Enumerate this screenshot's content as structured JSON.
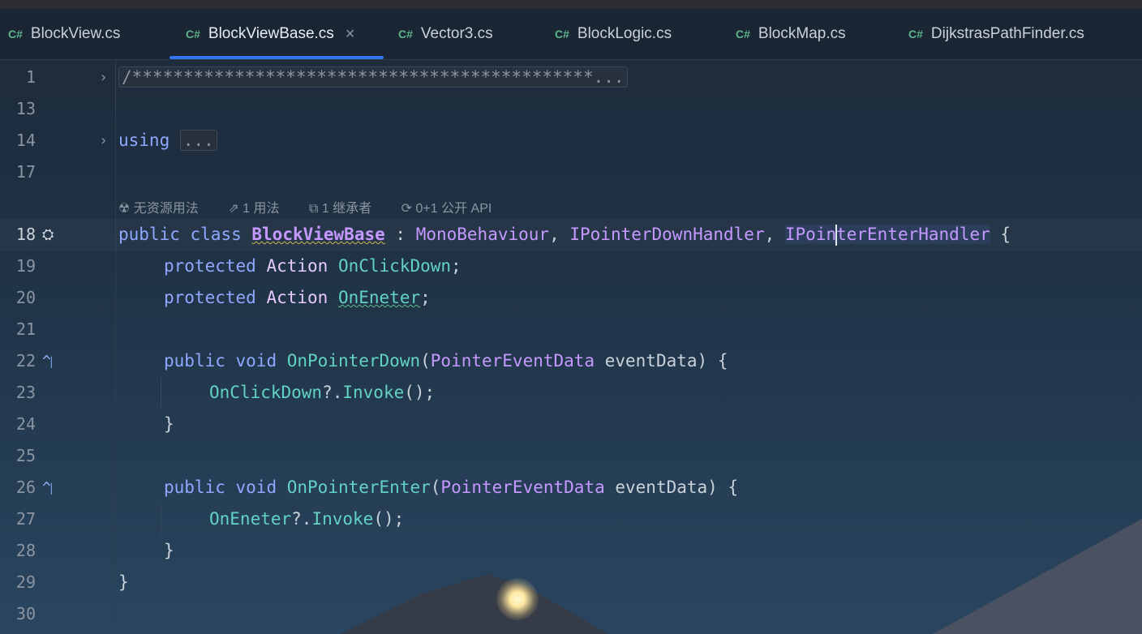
{
  "tabs": [
    {
      "icon": "C#",
      "label": "BlockView.cs"
    },
    {
      "icon": "C#",
      "label": "BlockViewBase.cs",
      "close": "×"
    },
    {
      "icon": "C#",
      "label": "Vector3.cs"
    },
    {
      "icon": "C#",
      "label": "BlockLogic.cs"
    },
    {
      "icon": "C#",
      "label": "BlockMap.cs"
    },
    {
      "icon": "C#",
      "label": "DijkstrasPathFinder.cs"
    }
  ],
  "lines": {
    "n1": "1",
    "n13": "13",
    "n14": "14",
    "n17": "17",
    "n18": "18",
    "n19": "19",
    "n20": "20",
    "n21": "21",
    "n22": "22",
    "n23": "23",
    "n24": "24",
    "n25": "25",
    "n26": "26",
    "n27": "27",
    "n28": "28",
    "n29": "29",
    "n30": "30"
  },
  "code": {
    "fold_comment": "/*********************************************...",
    "using": "using",
    "using_fold": "...",
    "public": "public",
    "class": "class",
    "class_name": "BlockViewBase",
    "colon": " : ",
    "base1": "MonoBehaviour",
    "comma": ", ",
    "base2": "IPointerDownHandler",
    "base3a": "IPoin",
    "base3b": "terEnterHandler",
    "brace_open": " {",
    "protected": "protected",
    "action": "Action",
    "field1": "OnClickDown",
    "field2": "OnEneter",
    "semi": ";",
    "void": "void",
    "method1": "OnPointerDown",
    "method2": "OnPointerEnter",
    "param_type": "PointerEventData",
    "param_name": "eventData",
    "invoke": "Invoke",
    "call_tail": "();",
    "null_cond": "?.",
    "brace_close": "}",
    "paren_open": "(",
    "paren_close_brace": ") {"
  },
  "hints": {
    "h1": "无资源用法",
    "h2": "1 用法",
    "h3": "1 继承者",
    "h4": "0+1 公开 API"
  },
  "icons": {
    "tab_icon": "csharp-file-icon",
    "gutter18": "broom-icon",
    "gutter22": "implements-up-icon",
    "gutter26": "implements-up-icon"
  },
  "colors": {
    "keyword": "#8fa8ff",
    "type": "#c599ff",
    "method": "#62d2c3",
    "tab_accent": "#3574f0"
  }
}
